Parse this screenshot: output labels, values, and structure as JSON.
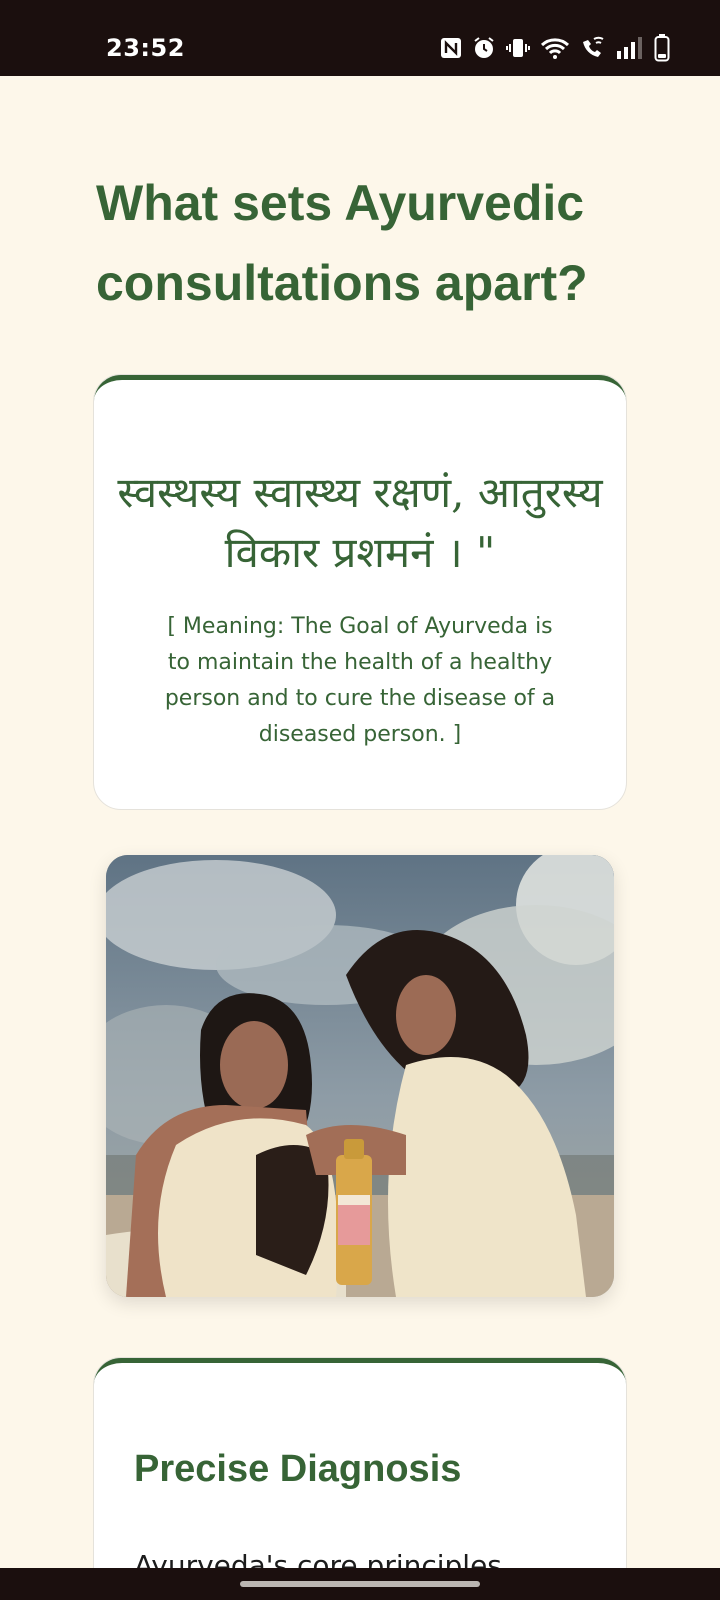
{
  "status_bar": {
    "time": "23:52",
    "icons": [
      "nfc-icon",
      "alarm-icon",
      "vibrate-icon",
      "wifi-icon",
      "wifi-calling-icon",
      "signal-icon",
      "battery-icon"
    ]
  },
  "page": {
    "title": "What sets Ayurvedic consultations apart?"
  },
  "quote_card": {
    "sanskrit": "स्वस्थस्य स्वास्थ्य रक्षणं, आतुरस्य विकार प्रशमनं । \"",
    "meaning": "[ Meaning: The Goal of Ayurveda is to maintain the health of a healthy person and to cure the disease of a diseased person. ]"
  },
  "photo": {
    "icon": "ayurveda-women-oil-photo"
  },
  "diagnosis_card": {
    "title": "Precise Diagnosis",
    "body": "Ayurveda's core principles revolve"
  },
  "colors": {
    "background": "#fdf7ea",
    "accent_green": "#376436",
    "system_bar": "#1b0f0e",
    "card": "#ffffff"
  }
}
